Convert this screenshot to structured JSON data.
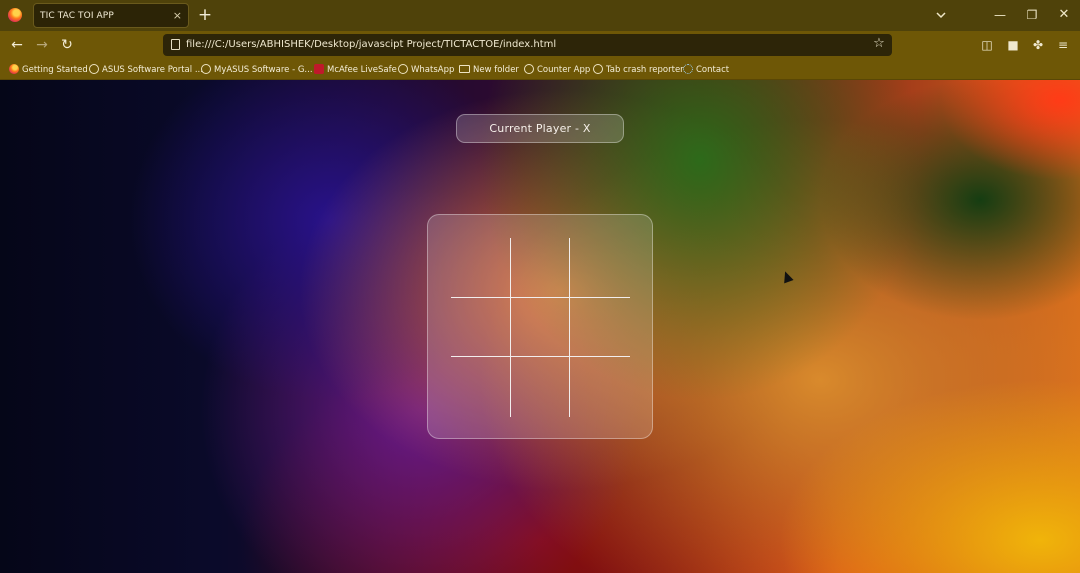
{
  "browser": {
    "tab": {
      "title": "TIC TAC TOI APP",
      "close": "×"
    },
    "new_tab": "+",
    "nav": {
      "back": "←",
      "forward": "→",
      "reload": "↻"
    },
    "url": "file:///C:/Users/ABHISHEK/Desktop/javascipt Project/TICTACTOE/index.html",
    "bookmark_star": "☆",
    "window": {
      "minimize": "—",
      "maximize": "❐",
      "close": "✕"
    },
    "toolbar": {
      "pocket": "◫",
      "extension": "■",
      "puzzle": "✤",
      "menu": "≡"
    }
  },
  "bookmarks": [
    {
      "label": "Getting Started",
      "icon": "firefox-icon"
    },
    {
      "label": "ASUS Software Portal ...",
      "icon": "globe-icon"
    },
    {
      "label": "MyASUS Software - G...",
      "icon": "globe-icon"
    },
    {
      "label": "McAfee LiveSafe",
      "icon": "mcafee-icon"
    },
    {
      "label": "WhatsApp",
      "icon": "globe-icon"
    },
    {
      "label": "New folder",
      "icon": "folder-icon"
    },
    {
      "label": "Counter App",
      "icon": "globe-icon"
    },
    {
      "label": "Tab crash reporter",
      "icon": "globe-icon"
    },
    {
      "label": "Contact",
      "icon": "gear-icon"
    }
  ],
  "game": {
    "status": "Current Player - X",
    "cells": [
      "",
      "",
      "",
      "",
      "",
      "",
      "",
      "",
      ""
    ]
  }
}
